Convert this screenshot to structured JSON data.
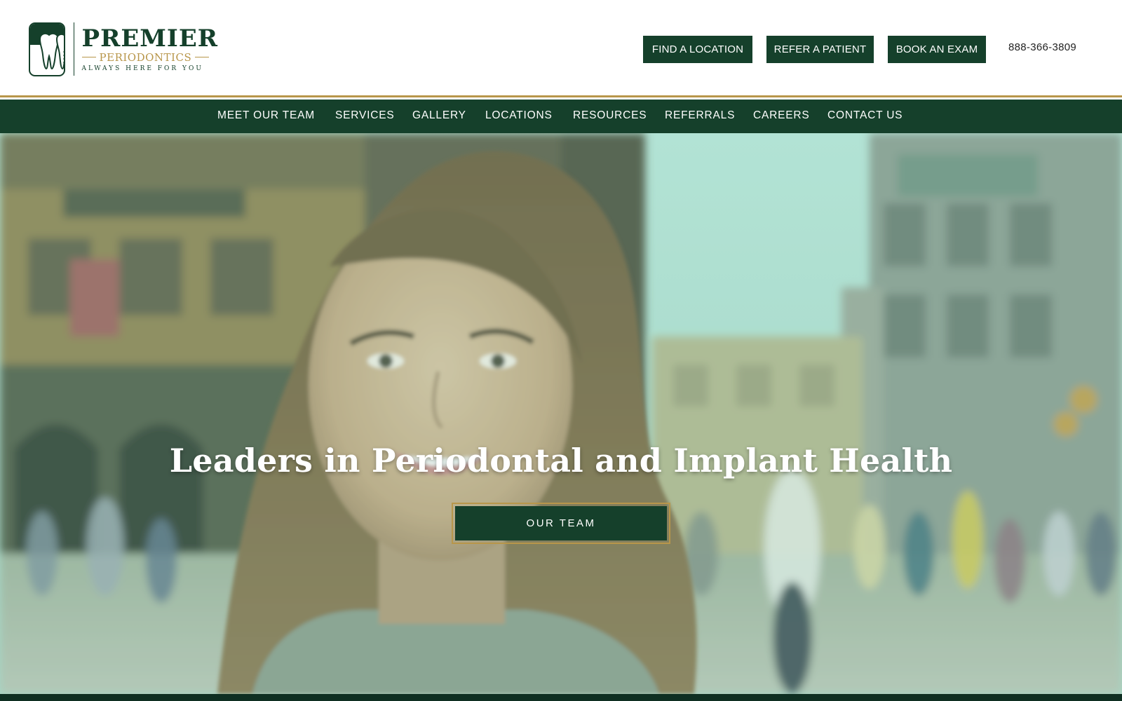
{
  "brand": {
    "name": "PREMIER",
    "subtitle": "PERIODONTICS",
    "tagline": "ALWAYS HERE FOR YOU"
  },
  "header": {
    "buttons": [
      {
        "label": "FIND A LOCATION"
      },
      {
        "label": "REFER A PATIENT"
      },
      {
        "label": "BOOK AN EXAM"
      }
    ],
    "phone": "888-366-3809"
  },
  "nav": {
    "items": [
      {
        "label": "MEET OUR TEAM"
      },
      {
        "label": "SERVICES"
      },
      {
        "label": "GALLERY"
      },
      {
        "label": "LOCATIONS"
      },
      {
        "label": "RESOURCES"
      },
      {
        "label": "REFERRALS"
      },
      {
        "label": "CAREERS"
      },
      {
        "label": "CONTACT US"
      }
    ]
  },
  "hero": {
    "title": "Leaders in Periodontal and Implant Health",
    "cta_label": "OUR TEAM"
  },
  "colors": {
    "brand_green": "#15402b",
    "gold": "#b8964a",
    "white": "#ffffff"
  }
}
